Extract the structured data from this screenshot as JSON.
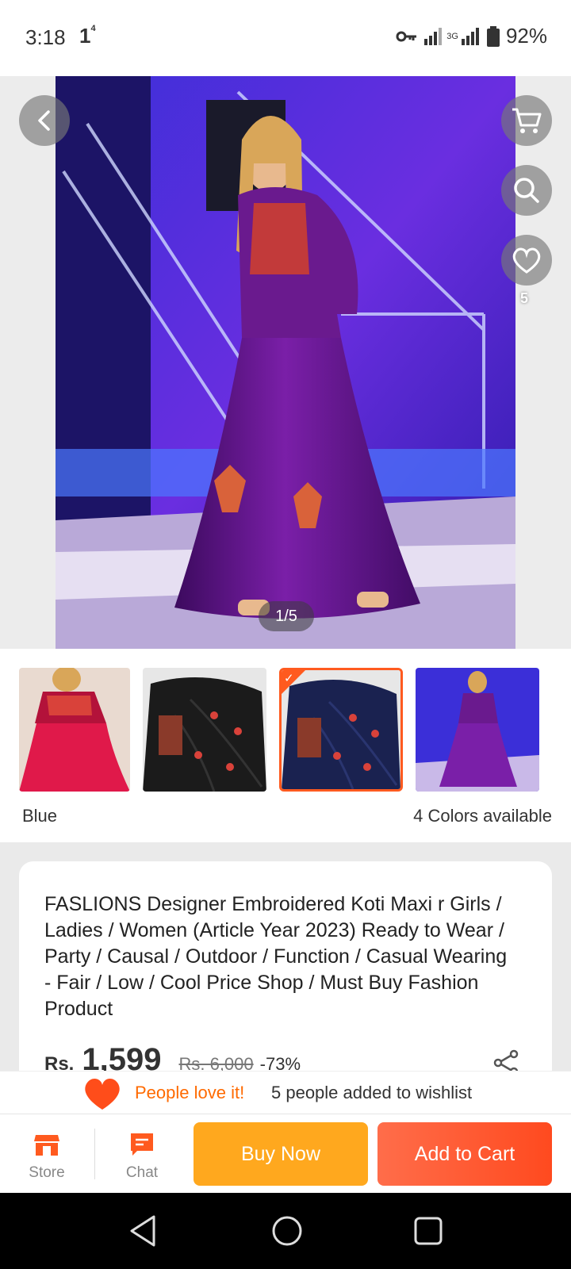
{
  "status_bar": {
    "time": "3:18",
    "indicator": "1",
    "indicator_sup": "4",
    "network_label": "3G",
    "battery": "92%"
  },
  "hero": {
    "page_indicator": "1/5",
    "wishlist_count": "5",
    "icons": [
      "back-icon",
      "cart-icon",
      "search-icon",
      "heart-icon"
    ]
  },
  "variants": {
    "selected_color": "Blue",
    "colors_available": "4 Colors available",
    "selected_index": 2
  },
  "product": {
    "title": "FASLIONS Designer Embroidered Koti Maxi r Girls / Ladies / Women (Article Year 2023) Ready to Wear / Party / Causal / Outdoor / Function / Casual Wearing - Fair / Low / Cool Price Shop / Must Buy Fashion Product",
    "currency": "Rs.",
    "price": "1,599",
    "original_price": "Rs. 6,000",
    "discount": "-73%"
  },
  "wishlist_banner": {
    "love_text": "People love it!",
    "added_text": "5 people added to wishlist"
  },
  "action_bar": {
    "store_label": "Store",
    "chat_label": "Chat",
    "buy_now_label": "Buy Now",
    "add_to_cart_label": "Add to Cart"
  },
  "colors": {
    "accent_orange": "#ff5a1f",
    "buy_now": "#ffa81e",
    "add_to_cart": "#ff4a1f",
    "love_text": "#ff6a00"
  }
}
